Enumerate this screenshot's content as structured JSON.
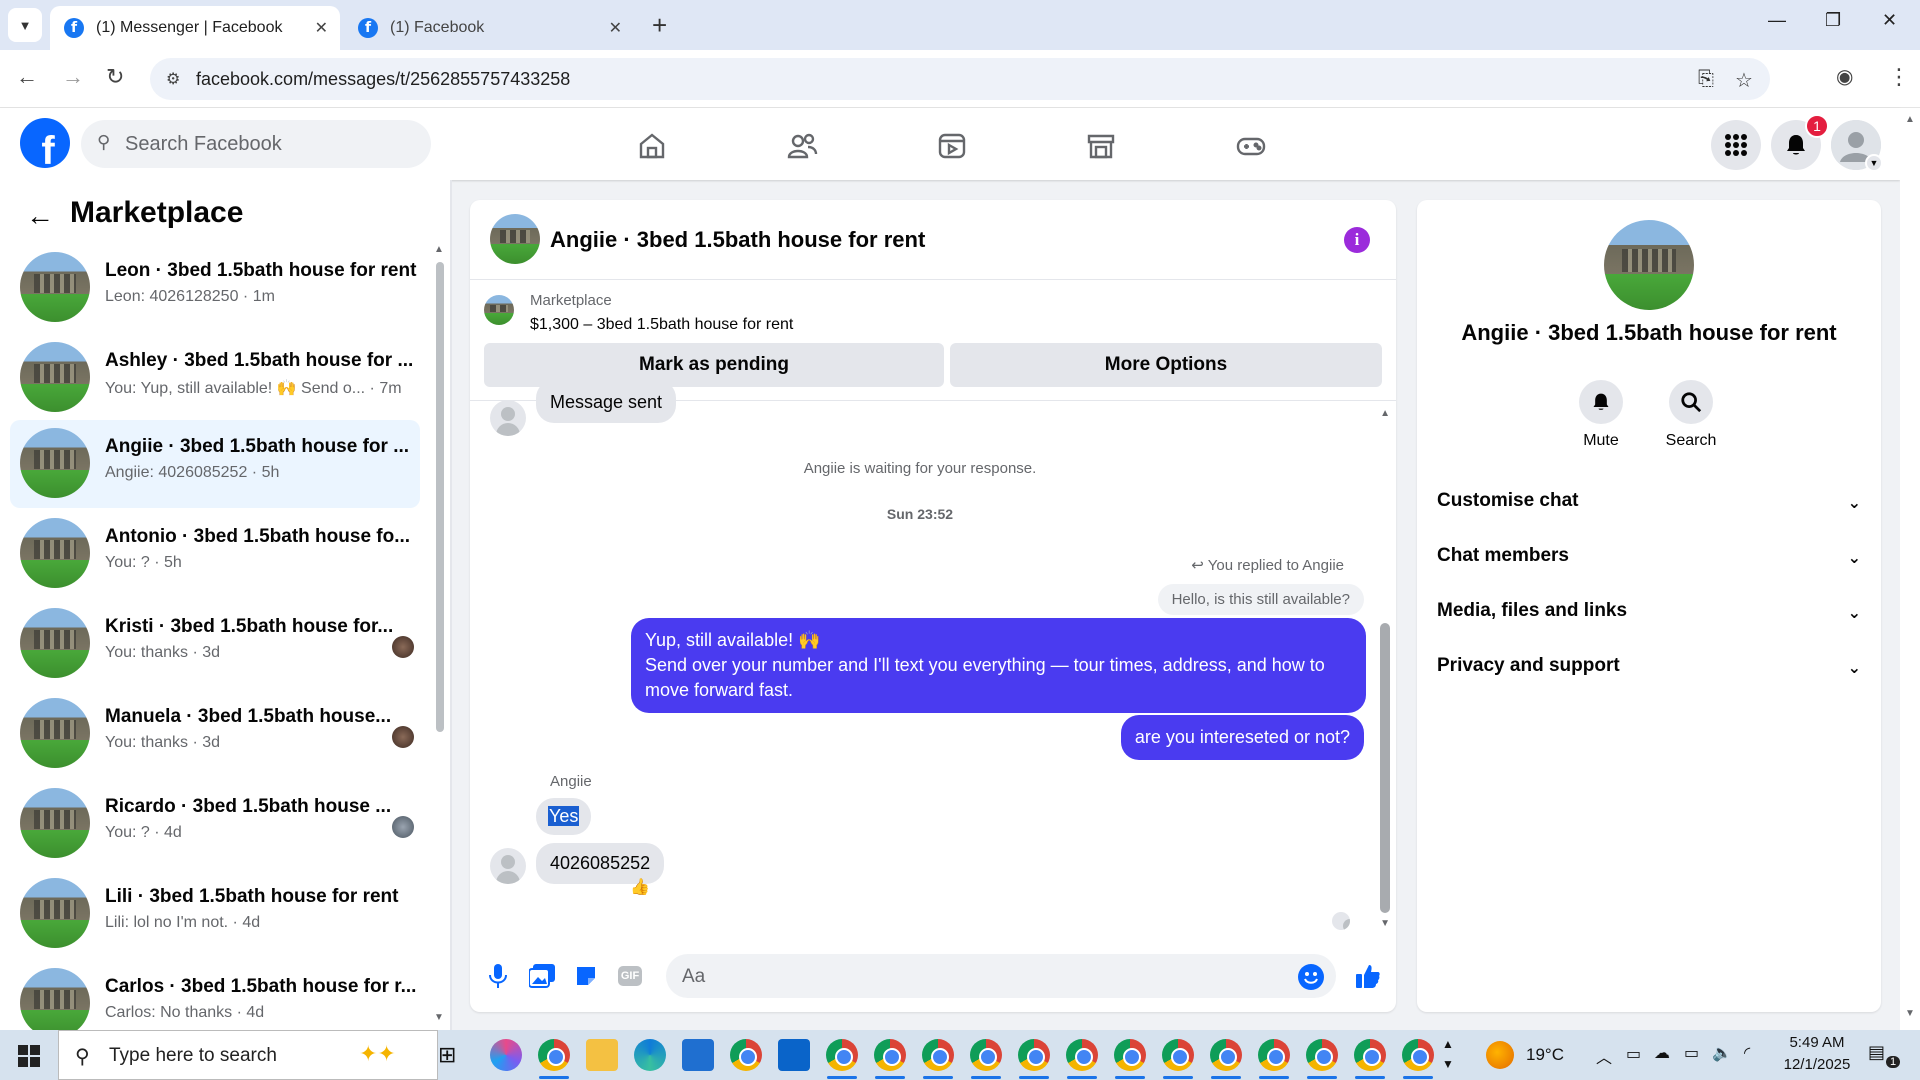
{
  "browser": {
    "tabs": [
      {
        "label": "(1) Messenger | Facebook",
        "active": true
      },
      {
        "label": "(1) Facebook",
        "active": false
      }
    ],
    "url": "facebook.com/messages/t/2562855757433258",
    "icons": [
      "chevron-down-icon",
      "close-icon",
      "plus-icon",
      "back-icon",
      "forward-icon",
      "reload-icon",
      "site-settings-icon",
      "install-icon",
      "star-icon",
      "profile-icon",
      "kebab-menu-icon"
    ]
  },
  "fb": {
    "search_placeholder": "Search Facebook",
    "notifications_count": "1",
    "nav_icons": [
      "home-icon",
      "friends-icon",
      "video-icon",
      "marketplace-icon",
      "gaming-icon"
    ]
  },
  "sidebar": {
    "title": "Marketplace",
    "conversations": [
      {
        "name": "Leon · 3bed 1.5bath house for rent",
        "sub": "Leon: 4026128250 · 1m"
      },
      {
        "name": "Ashley · 3bed 1.5bath house for ...",
        "sub": "You: Yup, still available! 🙌 Send o... · 7m"
      },
      {
        "name": "Angiie · 3bed 1.5bath house for ...",
        "sub": "Angiie: 4026085252 · 5h"
      },
      {
        "name": "Antonio · 3bed 1.5bath house fo...",
        "sub": "You: ? · 5h"
      },
      {
        "name": "Kristi · 3bed 1.5bath house for...",
        "sub": "You: thanks · 3d"
      },
      {
        "name": "Manuela · 3bed 1.5bath house...",
        "sub": "You: thanks · 3d"
      },
      {
        "name": "Ricardo · 3bed 1.5bath house ...",
        "sub": "You: ? · 4d"
      },
      {
        "name": "Lili · 3bed 1.5bath house for rent",
        "sub": "Lili: lol no I'm not. · 4d"
      },
      {
        "name": "Carlos · 3bed 1.5bath house for r...",
        "sub": "Carlos: No thanks · 4d"
      }
    ]
  },
  "chat": {
    "title": "Angiie · 3bed 1.5bath house for rent",
    "marketplace_label": "Marketplace",
    "listing": "$1,300 – 3bed 1.5bath house for rent",
    "mark_pending": "Mark as pending",
    "more_options": "More Options",
    "message_sent": "Message sent",
    "waiting": "Angiie is waiting for your response.",
    "timestamp": "Sun 23:52",
    "replied_note": "You replied to Angiie",
    "quoted": "Hello, is this still available?",
    "out_msg_1_line1": "Yup, still available! 🙌",
    "out_msg_1_line2": "Send over your number and I'll text you everything — tour times, address, and how to move forward fast.",
    "out_msg_2": "are you intereseted or not?",
    "sender_name": "Angiie",
    "in_msg_yes": "Yes",
    "in_msg_number": "4026085252",
    "reaction": "👍",
    "composer_placeholder": "Aa",
    "gif_label": "GIF"
  },
  "info_panel": {
    "title": "Angiie · 3bed 1.5bath house for rent",
    "actions": [
      "Mute",
      "Search"
    ],
    "rows": [
      "Customise chat",
      "Chat members",
      "Media, files and links",
      "Privacy and support"
    ]
  },
  "taskbar": {
    "search_placeholder": "Type here to search",
    "weather": "19°C",
    "time": "5:49 AM",
    "date": "12/1/2025",
    "notifications": "1"
  }
}
